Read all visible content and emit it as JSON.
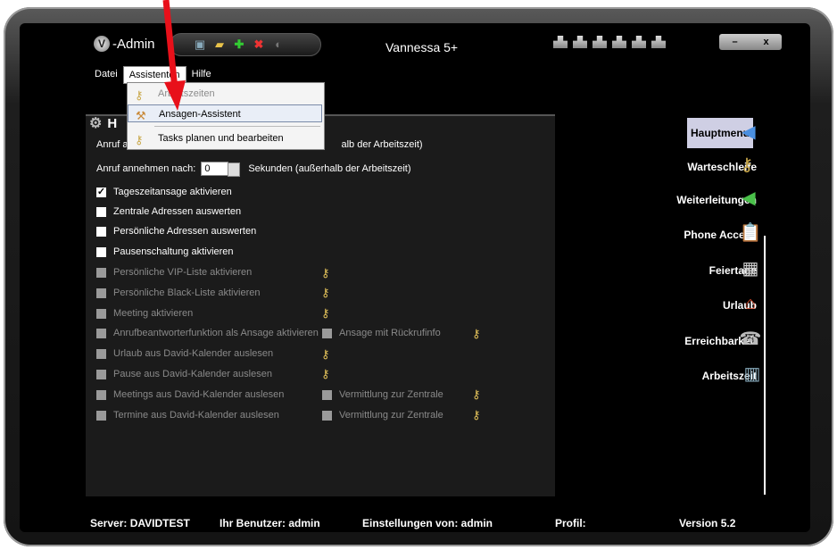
{
  "app": {
    "logo_text": "-Admin",
    "title": "Vannessa 5+"
  },
  "window_buttons": {
    "minimize": "–",
    "close": "x"
  },
  "menu": {
    "file": "Datei",
    "assistants": "Assistenten",
    "help": "Hilfe"
  },
  "dropdown": {
    "items": [
      {
        "label": "Arbeitszeiten",
        "state": "disabled"
      },
      {
        "label": "Ansagen-Assistent",
        "state": "highlighted"
      },
      {
        "label": "Tasks planen und bearbeiten",
        "state": "normal"
      }
    ]
  },
  "panel": {
    "title": "H"
  },
  "form": {
    "row1": {
      "label": "Anruf a",
      "suffix": "alb der Arbeitszeit)"
    },
    "row2": {
      "label": "Anruf annehmen nach:",
      "value": "0",
      "suffix": "Sekunden (außerhalb der Arbeitszeit)"
    },
    "checkboxes": [
      {
        "label": "Tageszeitansage aktivieren",
        "checked": true,
        "enabled": true
      },
      {
        "label": "Zentrale Adressen auswerten",
        "checked": false,
        "enabled": true
      },
      {
        "label": "Persönliche Adressen auswerten",
        "checked": false,
        "enabled": true
      },
      {
        "label": "Pausenschaltung aktivieren",
        "checked": false,
        "enabled": true
      },
      {
        "label": "Persönliche VIP-Liste aktivieren",
        "checked": false,
        "enabled": false
      },
      {
        "label": "Persönliche Black-Liste aktivieren",
        "checked": false,
        "enabled": false
      },
      {
        "label": "Meeting aktivieren",
        "checked": false,
        "enabled": false
      },
      {
        "label": "Anrufbeantworterfunktion als Ansage aktivieren",
        "checked": false,
        "enabled": false
      },
      {
        "label": "Urlaub aus David-Kalender auslesen",
        "checked": false,
        "enabled": false
      },
      {
        "label": "Pause aus David-Kalender auslesen",
        "checked": false,
        "enabled": false
      },
      {
        "label": "Meetings aus David-Kalender auslesen",
        "checked": false,
        "enabled": false
      },
      {
        "label": "Termine aus David-Kalender auslesen",
        "checked": false,
        "enabled": false
      }
    ],
    "extra": {
      "ansage_rueckruf": "Ansage mit Rückrufinfo",
      "vermittlung1": "Vermittlung zur Zentrale",
      "vermittlung2": "Vermittlung zur Zentrale"
    }
  },
  "sidebar": {
    "items": [
      {
        "label": "Hauptmenu",
        "icon": "back-arrow-icon"
      },
      {
        "label": "Warteschleife",
        "icon": "keys-icon"
      },
      {
        "label": "Weiterleitungen",
        "icon": "forward-arrow-icon"
      },
      {
        "label": "Phone Access",
        "icon": "clipboard-icon"
      },
      {
        "label": "Feiertage",
        "icon": "calendar-icon"
      },
      {
        "label": "Urlaub",
        "icon": "house-icon"
      },
      {
        "label": "Erreichbarkeit",
        "icon": "phone-icon"
      },
      {
        "label": "Arbeitszeit",
        "icon": "building-icon"
      }
    ]
  },
  "footer": {
    "server": "Server: DAVIDTEST",
    "user": "Ihr Benutzer: admin",
    "settings": "Einstellungen von: admin",
    "profile": "Profil:",
    "version": "Version 5.2"
  },
  "colors": {
    "accent_arrow": "#e8101a",
    "highlight": "#cfcfe4"
  }
}
